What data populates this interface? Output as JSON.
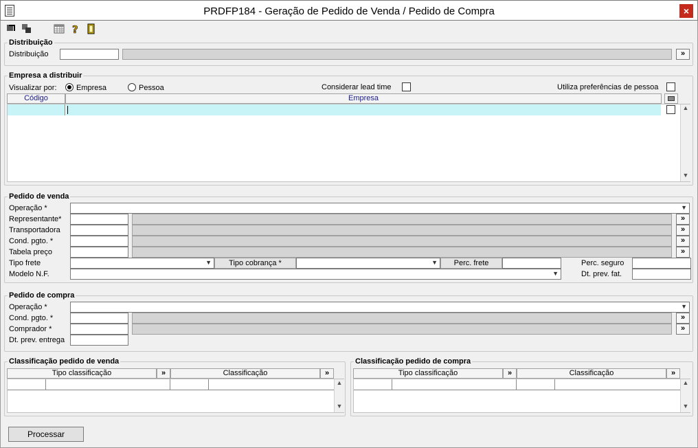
{
  "window": {
    "title": "PRDFP184 - Geração de Pedido de Venda / Pedido de Compra",
    "close_label": "×"
  },
  "toolbar": {
    "icons": [
      "arrow-in-icon",
      "copy-icon",
      "calendar-grid-icon",
      "help-icon",
      "exit-door-icon"
    ]
  },
  "distribuicao": {
    "legend": "Distribuição",
    "label": "Distribuição",
    "value": "",
    "lookup_label": "»"
  },
  "empresa": {
    "legend": "Empresa a distribuir",
    "visualizar_label": "Visualizar por:",
    "radio_empresa": "Empresa",
    "radio_pessoa": "Pessoa",
    "selected": "Empresa",
    "lead_time_label": "Considerar lead time",
    "lead_time_checked": false,
    "pref_label": "Utiliza preferências de pessoa",
    "pref_checked": false,
    "col_codigo": "Código",
    "col_empresa": "Empresa"
  },
  "venda": {
    "legend": "Pedido de venda",
    "operacao_label": "Operação *",
    "representante_label": "Representante*",
    "transportadora_label": "Transportadora",
    "cond_label": "Cond. pgto. *",
    "tabela_label": "Tabela preço",
    "tipo_frete_label": "Tipo frete",
    "tipo_cobranca_label": "Tipo cobrança *",
    "perc_frete_label": "Perc. frete",
    "perc_seguro_label": "Perc. seguro",
    "modelo_label": "Modelo N.F.",
    "dt_fat_label": "Dt. prev. fat.",
    "lookup_label": "»"
  },
  "compra": {
    "legend": "Pedido de compra",
    "operacao_label": "Operação *",
    "cond_label": "Cond. pgto. *",
    "comprador_label": "Comprador *",
    "dt_entrega_label": "Dt. prev. entrega",
    "lookup_label": "»"
  },
  "class_venda": {
    "legend": "Classificação pedido de venda",
    "col_tipo": "Tipo classificação",
    "col_class": "Classificação",
    "lookup_label": "»"
  },
  "class_compra": {
    "legend": "Classificação pedido de compra",
    "col_tipo": "Tipo classificação",
    "col_class": "Classificação",
    "lookup_label": "»"
  },
  "processar_label": "Processar"
}
